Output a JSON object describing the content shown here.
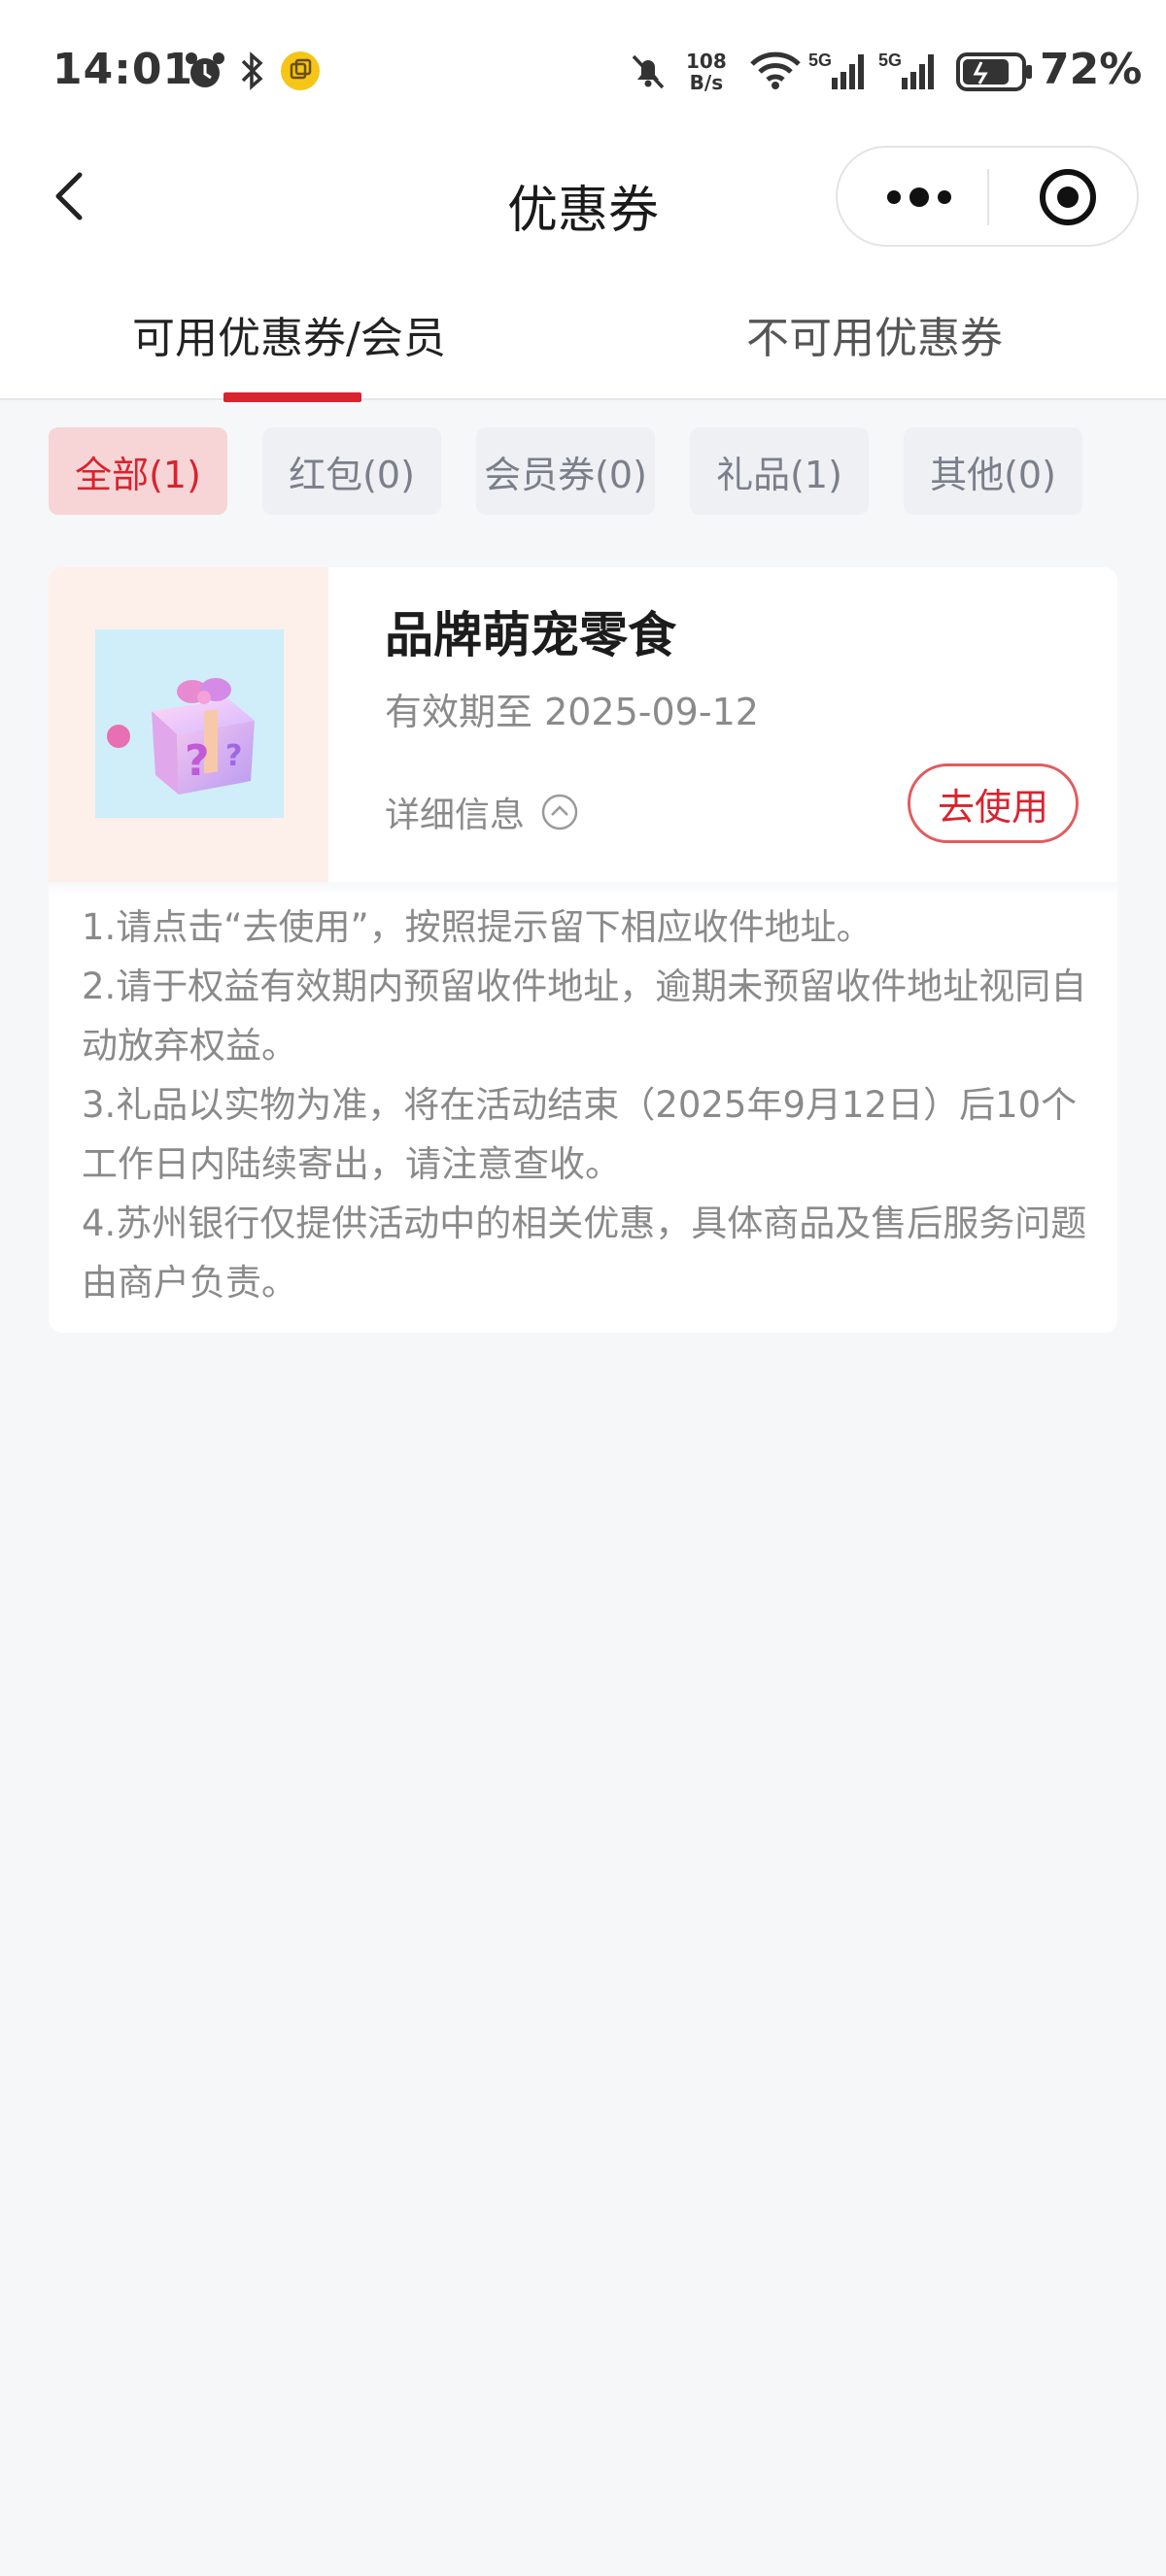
{
  "status_bar": {
    "time": "14:01",
    "net_speed_value": "108",
    "net_speed_unit": "B/s",
    "signal_1_label": "5G",
    "signal_2_label": "5G",
    "battery_pct": "72%",
    "icons": [
      "alarm-icon",
      "bluetooth-icon",
      "app-notification-icon",
      "mute-icon",
      "wifi-icon",
      "signal-icon",
      "battery-charging-icon"
    ]
  },
  "nav": {
    "title": "优惠券",
    "back_icon": "chevron-left-icon",
    "more_icon": "more-dots-icon",
    "close_icon": "target-close-icon"
  },
  "tabs": [
    {
      "label": "可用优惠券/会员",
      "active": true
    },
    {
      "label": "不可用优惠券",
      "active": false
    }
  ],
  "filters": [
    {
      "label": "全部(1)",
      "active": true
    },
    {
      "label": "红包(0)",
      "active": false
    },
    {
      "label": "会员券(0)",
      "active": false
    },
    {
      "label": "礼品(1)",
      "active": false
    },
    {
      "label": "其他(0)",
      "active": false
    }
  ],
  "coupon": {
    "title": "品牌萌宠零食",
    "expire": "有效期至 2025-09-12",
    "detail_label": "详细信息",
    "use_label": "去使用",
    "image": "gift-box-icon",
    "rules": [
      "1.请点击“去使用”，按照提示留下相应收件地址。",
      "2.请于权益有效期内预留收件地址，逾期未预留收件地址视同自动放弃权益。",
      "3.礼品以实物为准，将在活动结束（2025年9月12日）后10个工作日内陆续寄出，请注意查收。",
      "4.苏州银行仅提供活动中的相关优惠，具体商品及售后服务问题由商户负责。"
    ]
  },
  "colors": {
    "accent": "#d9232e",
    "chip_active_bg": "#f7d5d6",
    "chip_bg": "#eef0f4",
    "page_bg": "#f6f7f9"
  }
}
